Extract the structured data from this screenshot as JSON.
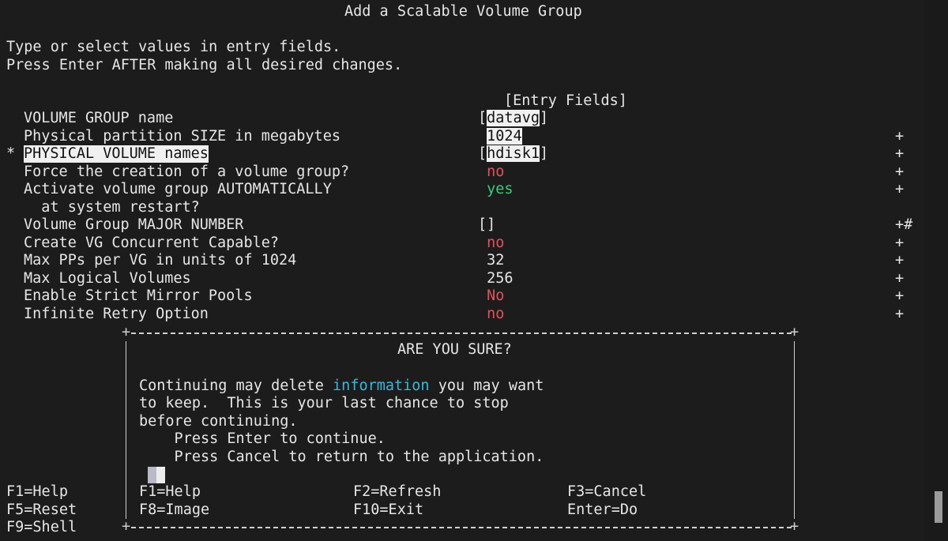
{
  "screen": {
    "title": "Add a Scalable Volume Group",
    "instructions": [
      "Type or select values in entry fields.",
      "Press Enter AFTER making all desired changes."
    ],
    "entry_fields_header": "[Entry Fields]"
  },
  "fields": [
    {
      "marker": "",
      "label": "VOLUME GROUP name",
      "open": "[",
      "value": "datavg",
      "close": "]",
      "value_style": "highlight",
      "suffix": ""
    },
    {
      "marker": "",
      "label": "Physical partition SIZE in megabytes",
      "open": " ",
      "value": "1024",
      "close": "",
      "value_style": "highlight",
      "suffix": "+"
    },
    {
      "marker": "*",
      "label": "PHYSICAL VOLUME names",
      "open": "[",
      "value": "hdisk1",
      "close": "]",
      "value_style": "highlight",
      "suffix": "+",
      "label_highlight": true
    },
    {
      "marker": "",
      "label": "Force the creation of a volume group?",
      "open": " ",
      "value": "no",
      "close": "",
      "value_style": "red",
      "suffix": "+"
    },
    {
      "marker": "",
      "label": "Activate volume group AUTOMATICALLY",
      "label2": "  at system restart?",
      "open": " ",
      "value": "yes",
      "close": "",
      "value_style": "green",
      "suffix": "+"
    },
    {
      "marker": "",
      "label": "Volume Group MAJOR NUMBER",
      "open": "[",
      "value": "",
      "close": "]",
      "value_style": "plain",
      "suffix": "+#"
    },
    {
      "marker": "",
      "label": "Create VG Concurrent Capable?",
      "open": " ",
      "value": "no",
      "close": "",
      "value_style": "red",
      "suffix": "+"
    },
    {
      "marker": "",
      "label": "Max PPs per VG in units of 1024",
      "open": " ",
      "value": "32",
      "close": "",
      "value_style": "plain",
      "suffix": "+"
    },
    {
      "marker": "",
      "label": "Max Logical Volumes",
      "open": " ",
      "value": "256",
      "close": "",
      "value_style": "plain",
      "suffix": "+"
    },
    {
      "marker": "",
      "label": "Enable Strict Mirror Pools",
      "open": " ",
      "value": "No",
      "close": "",
      "value_style": "red",
      "suffix": "+"
    },
    {
      "marker": "",
      "label": "Infinite Retry Option",
      "open": " ",
      "value": "no",
      "close": "",
      "value_style": "red",
      "suffix": "+"
    }
  ],
  "dialog": {
    "title": "ARE YOU SURE?",
    "line1_pre": "Continuing may delete ",
    "line1_highlight": "information",
    "line1_post": " you may want",
    "line2": "to keep.  This is your last chance to stop",
    "line3": "before continuing.",
    "line4": "    Press Enter to continue.",
    "line5": "    Press Cancel to return to the application.",
    "keys": [
      [
        "F1=Help",
        "F2=Refresh",
        "F3=Cancel"
      ],
      [
        "F8=Image",
        "F10=Exit",
        "Enter=Do"
      ]
    ]
  },
  "background_keys": [
    "F1=Help",
    "F5=Reset",
    "F9=Shell"
  ]
}
